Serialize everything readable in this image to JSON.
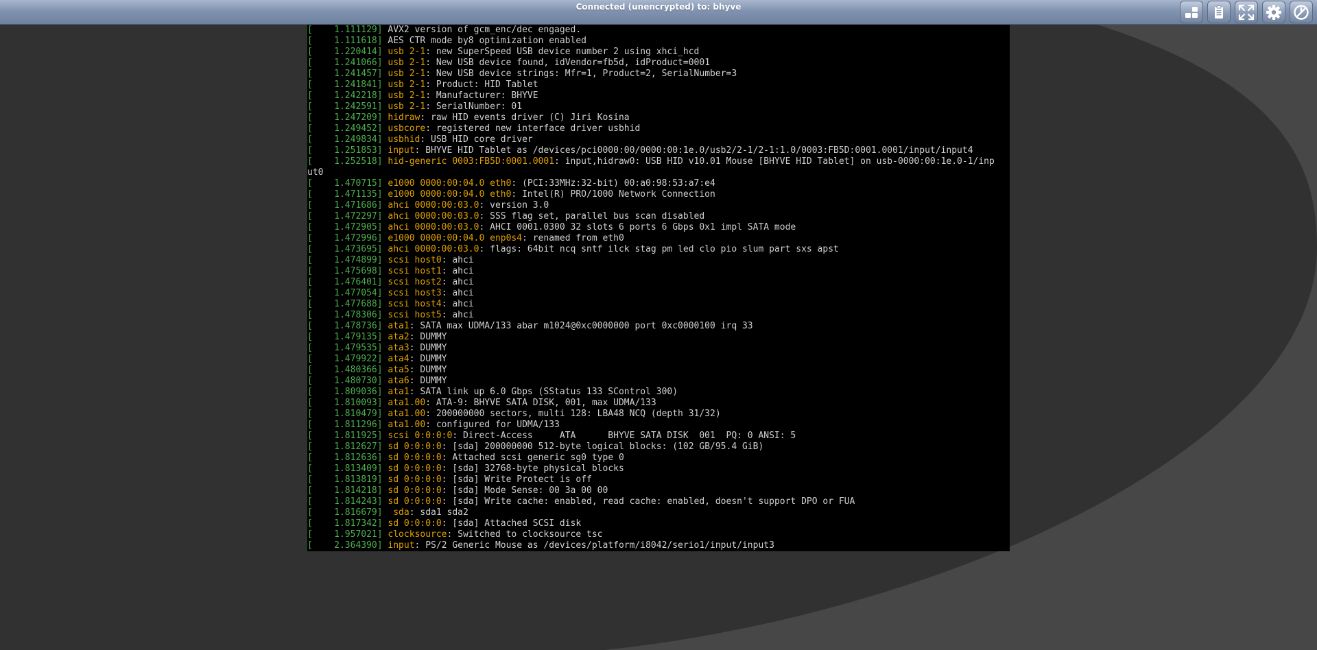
{
  "connection": {
    "status_text": "Connected (unencrypted) to: bhyve"
  },
  "controls": [
    {
      "name": "extra-keys",
      "icon": "extra-keys-icon",
      "interactable": true
    },
    {
      "name": "clipboard",
      "icon": "clipboard-icon",
      "interactable": true
    },
    {
      "name": "fullscreen",
      "icon": "fullscreen-icon",
      "interactable": true
    },
    {
      "name": "settings",
      "icon": "gear-icon",
      "interactable": true
    },
    {
      "name": "disconnect",
      "icon": "power-icon",
      "interactable": true
    }
  ],
  "colors": {
    "timestamp": "#4eb04e",
    "source": "#e0a000",
    "message": "#d0d0d0",
    "console_background": "#000000",
    "page_background": "#313131"
  },
  "console_lines": [
    {
      "ts": "1.111129",
      "src": "",
      "msg": "AVX2 version of gcm_enc/dec engaged."
    },
    {
      "ts": "1.111618",
      "src": "",
      "msg": "AES CTR mode by8 optimization enabled"
    },
    {
      "ts": "1.220414",
      "src": "usb 2-1",
      "msg": ": new SuperSpeed USB device number 2 using xhci_hcd"
    },
    {
      "ts": "1.241066",
      "src": "usb 2-1",
      "msg": ": New USB device found, idVendor=fb5d, idProduct=0001"
    },
    {
      "ts": "1.241457",
      "src": "usb 2-1",
      "msg": ": New USB device strings: Mfr=1, Product=2, SerialNumber=3"
    },
    {
      "ts": "1.241841",
      "src": "usb 2-1",
      "msg": ": Product: HID Tablet"
    },
    {
      "ts": "1.242218",
      "src": "usb 2-1",
      "msg": ": Manufacturer: BHYVE"
    },
    {
      "ts": "1.242591",
      "src": "usb 2-1",
      "msg": ": SerialNumber: 01"
    },
    {
      "ts": "1.247209",
      "src": "hidraw",
      "msg": ": raw HID events driver (C) Jiri Kosina"
    },
    {
      "ts": "1.249452",
      "src": "usbcore",
      "msg": ": registered new interface driver usbhid"
    },
    {
      "ts": "1.249834",
      "src": "usbhid",
      "msg": ": USB HID core driver"
    },
    {
      "ts": "1.251853",
      "src": "input",
      "msg": ": BHYVE HID Tablet as /devices/pci0000:00/0000:00:1e.0/usb2/2-1/2-1:1.0/0003:FB5D:0001.0001/input/input4"
    },
    {
      "ts": "1.252518",
      "src": "hid-generic 0003:FB5D:0001.0001",
      "msg": ": input,hidraw0: USB HID v10.01 Mouse [BHYVE HID Tablet] on usb-0000:00:1e.0-1/inp"
    },
    {
      "cont": "ut0"
    },
    {
      "ts": "1.470715",
      "src": "e1000 0000:00:04.0 eth0",
      "msg": ": (PCI:33MHz:32-bit) 00:a0:98:53:a7:e4"
    },
    {
      "ts": "1.471135",
      "src": "e1000 0000:00:04.0 eth0",
      "msg": ": Intel(R) PRO/1000 Network Connection"
    },
    {
      "ts": "1.471686",
      "src": "ahci 0000:00:03.0",
      "msg": ": version 3.0"
    },
    {
      "ts": "1.472297",
      "src": "ahci 0000:00:03.0",
      "msg": ": SSS flag set, parallel bus scan disabled"
    },
    {
      "ts": "1.472905",
      "src": "ahci 0000:00:03.0",
      "msg": ": AHCI 0001.0300 32 slots 6 ports 6 Gbps 0x1 impl SATA mode"
    },
    {
      "ts": "1.472996",
      "src": "e1000 0000:00:04.0 enp0s4",
      "msg": ": renamed from eth0"
    },
    {
      "ts": "1.473695",
      "src": "ahci 0000:00:03.0",
      "msg": ": flags: 64bit ncq sntf ilck stag pm led clo pio slum part sxs apst"
    },
    {
      "ts": "1.474899",
      "src": "scsi host0",
      "msg": ": ahci"
    },
    {
      "ts": "1.475698",
      "src": "scsi host1",
      "msg": ": ahci"
    },
    {
      "ts": "1.476401",
      "src": "scsi host2",
      "msg": ": ahci"
    },
    {
      "ts": "1.477054",
      "src": "scsi host3",
      "msg": ": ahci"
    },
    {
      "ts": "1.477688",
      "src": "scsi host4",
      "msg": ": ahci"
    },
    {
      "ts": "1.478306",
      "src": "scsi host5",
      "msg": ": ahci"
    },
    {
      "ts": "1.478736",
      "src": "ata1",
      "msg": ": SATA max UDMA/133 abar m1024@0xc0000000 port 0xc0000100 irq 33"
    },
    {
      "ts": "1.479135",
      "src": "ata2",
      "msg": ": DUMMY"
    },
    {
      "ts": "1.479535",
      "src": "ata3",
      "msg": ": DUMMY"
    },
    {
      "ts": "1.479922",
      "src": "ata4",
      "msg": ": DUMMY"
    },
    {
      "ts": "1.480366",
      "src": "ata5",
      "msg": ": DUMMY"
    },
    {
      "ts": "1.480730",
      "src": "ata6",
      "msg": ": DUMMY"
    },
    {
      "ts": "1.809036",
      "src": "ata1",
      "msg": ": SATA link up 6.0 Gbps (SStatus 133 SControl 300)"
    },
    {
      "ts": "1.810093",
      "src": "ata1.00",
      "msg": ": ATA-9: BHYVE SATA DISK, 001, max UDMA/133"
    },
    {
      "ts": "1.810479",
      "src": "ata1.00",
      "msg": ": 200000000 sectors, multi 128: LBA48 NCQ (depth 31/32)"
    },
    {
      "ts": "1.811296",
      "src": "ata1.00",
      "msg": ": configured for UDMA/133"
    },
    {
      "ts": "1.811925",
      "src": "scsi 0:0:0:0",
      "msg": ": Direct-Access     ATA      BHYVE SATA DISK  001  PQ: 0 ANSI: 5"
    },
    {
      "ts": "1.812627",
      "src": "sd 0:0:0:0",
      "msg": ": [sda] 200000000 512-byte logical blocks: (102 GB/95.4 GiB)"
    },
    {
      "ts": "1.812636",
      "src": "sd 0:0:0:0",
      "msg": ": Attached scsi generic sg0 type 0"
    },
    {
      "ts": "1.813409",
      "src": "sd 0:0:0:0",
      "msg": ": [sda] 32768-byte physical blocks"
    },
    {
      "ts": "1.813819",
      "src": "sd 0:0:0:0",
      "msg": ": [sda] Write Protect is off"
    },
    {
      "ts": "1.814218",
      "src": "sd 0:0:0:0",
      "msg": ": [sda] Mode Sense: 00 3a 00 00"
    },
    {
      "ts": "1.814243",
      "src": "sd 0:0:0:0",
      "msg": ": [sda] Write cache: enabled, read cache: enabled, doesn't support DPO or FUA"
    },
    {
      "ts": "1.816679",
      "src": " sda",
      "msg": ": sda1 sda2"
    },
    {
      "ts": "1.817342",
      "src": "sd 0:0:0:0",
      "msg": ": [sda] Attached SCSI disk"
    },
    {
      "ts": "1.957021",
      "src": "clocksource",
      "msg": ": Switched to clocksource tsc"
    },
    {
      "ts": "2.364390",
      "src": "input",
      "msg": ": PS/2 Generic Mouse as /devices/platform/i8042/serio1/input/input3"
    }
  ]
}
